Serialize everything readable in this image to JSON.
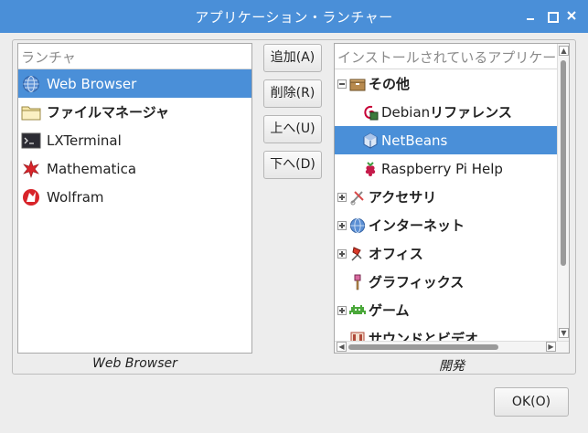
{
  "window": {
    "title": "アプリケーション・ランチャー"
  },
  "launcher": {
    "header": "ランチャ",
    "items": [
      {
        "label": "Web Browser",
        "icon": "globe-icon",
        "selected": true
      },
      {
        "label": "ファイルマネージャ",
        "icon": "folder-icon",
        "selected": false
      },
      {
        "label": "LXTerminal",
        "icon": "terminal-icon",
        "selected": false
      },
      {
        "label": "Mathematica",
        "icon": "mathematica-icon",
        "selected": false
      },
      {
        "label": "Wolfram",
        "icon": "wolfram-icon",
        "selected": false
      }
    ],
    "caption": "Web Browser"
  },
  "buttons": {
    "add": "追加(A)",
    "remove": "削除(R)",
    "up": "上へ(U)",
    "down": "下へ(D)",
    "ok": "OK(O)"
  },
  "installed": {
    "header": "インストールされているアプリケー",
    "tree": [
      {
        "label": "その他",
        "icon": "box-icon",
        "expander": "open",
        "level": 0
      },
      {
        "label_a": "Debian ",
        "label_b": "リファレンス",
        "icon": "debian-icon",
        "level": 1
      },
      {
        "label": "NetBeans",
        "icon": "netbeans-icon",
        "level": 1,
        "selected": true
      },
      {
        "label": "Raspberry Pi Help",
        "icon": "raspberry-icon",
        "level": 1
      },
      {
        "label": "アクセサリ",
        "icon": "accessories-icon",
        "expander": "closed",
        "level": 0
      },
      {
        "label": "インターネット",
        "icon": "globe-icon",
        "expander": "closed",
        "level": 0
      },
      {
        "label": "オフィス",
        "icon": "office-icon",
        "expander": "closed",
        "level": 0
      },
      {
        "label": "グラフィックス",
        "icon": "graphics-icon",
        "expander": "none",
        "level": 0
      },
      {
        "label": "ゲーム",
        "icon": "game-icon",
        "expander": "closed",
        "level": 0
      },
      {
        "label": "サウンドとビデオ",
        "icon": "sound-video-icon",
        "expander": "none",
        "level": 0
      }
    ],
    "caption": "開発"
  },
  "colors": {
    "titlebar": "#4a8fd8",
    "selection": "#4a8fd8"
  }
}
